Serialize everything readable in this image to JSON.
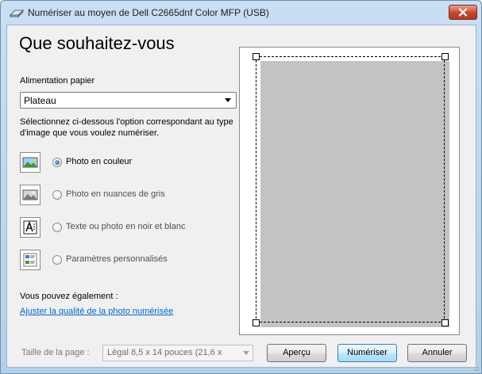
{
  "window": {
    "title": "Numériser au moyen de Dell C2665dnf Color MFP (USB)"
  },
  "heading": "Que souhaitez-vous",
  "paper_feed": {
    "label": "Alimentation papier",
    "value": "Plateau"
  },
  "instruction": "Sélectionnez ci-dessous l'option correspondant au type d'image que vous voulez numériser.",
  "options": [
    {
      "label": "Photo en couleur",
      "icon": "color-photo-icon",
      "selected": true
    },
    {
      "label": "Photo en nuances de gris",
      "icon": "grayscale-photo-icon",
      "selected": false
    },
    {
      "label": "Texte ou photo en noir et blanc",
      "icon": "black-white-text-icon",
      "selected": false
    },
    {
      "label": "Paramètres personnalisés",
      "icon": "custom-settings-icon",
      "selected": false
    }
  ],
  "also": {
    "label": "Vous pouvez également :",
    "link": "Ajuster la qualité de la photo numérisée"
  },
  "page_size": {
    "label": "Taille de la page :",
    "value": "Légal 8,5 x 14 pouces (21,6 x"
  },
  "buttons": {
    "preview": "Aperçu",
    "scan": "Numériser",
    "cancel": "Annuler"
  },
  "colors": {
    "link": "#0066cc",
    "close_button": "#c7452d",
    "scan_area": "#c3c3c3"
  }
}
